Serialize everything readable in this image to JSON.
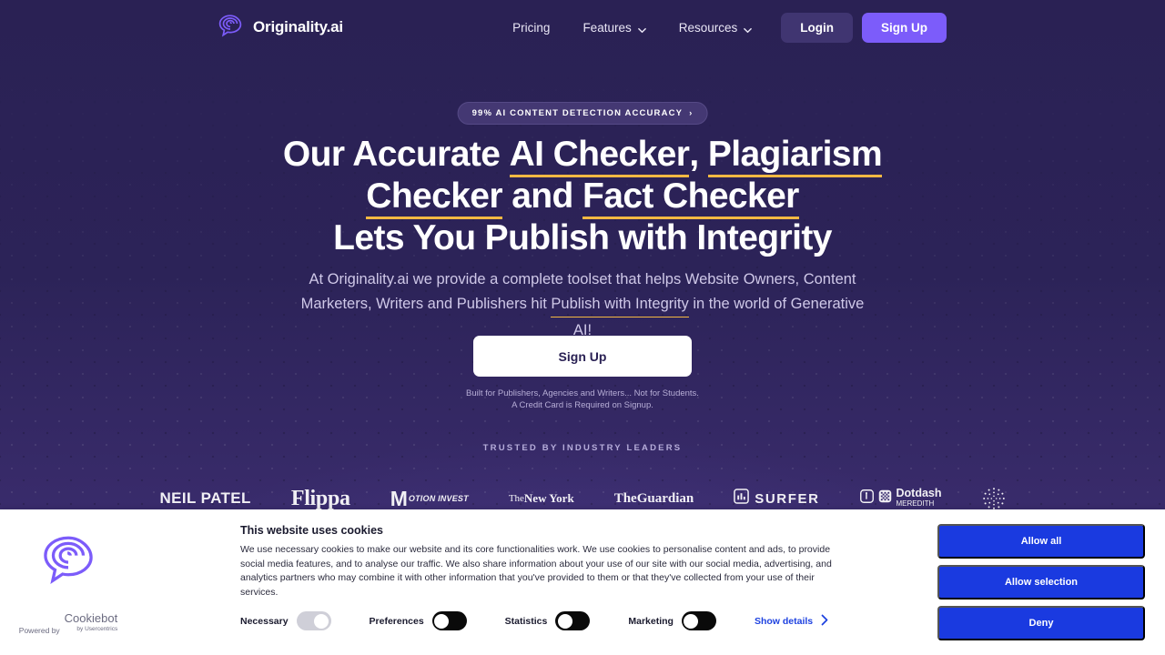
{
  "colors": {
    "hero_bg_top": "#2a2154",
    "hero_bg_bottom": "#41317a",
    "accent_purple": "#7c5cfa",
    "underline_gold": "#f5b942",
    "cookie_button_blue": "#1a3ae0",
    "show_details_blue": "#1e42e0"
  },
  "nav": {
    "brand": "Originality.ai",
    "brand_icon": "brain-speech-bubble-logo",
    "links": [
      {
        "label": "Pricing",
        "has_caret": false
      },
      {
        "label": "Features",
        "has_caret": true
      },
      {
        "label": "Resources",
        "has_caret": true
      }
    ],
    "login_label": "Login",
    "signup_label": "Sign Up"
  },
  "hero": {
    "badge_text": "99% AI CONTENT DETECTION ACCURACY",
    "badge_arrow": "›",
    "headline": {
      "line1_a": "Our Accurate ",
      "line1_b": "AI Checker",
      "line1_c": ", ",
      "line1_d": "Plagiarism",
      "line2_a": "Checker",
      "line2_b": " and ",
      "line2_c": "Fact Checker",
      "line3": "Lets You Publish with Integrity"
    },
    "subheading": {
      "part1": "At Originality.ai we provide a complete toolset that helps Website Owners, Content Marketers, Writers and Publishers hit ",
      "highlight": "Publish with Integrity",
      "part2": " in the world of Generative AI!"
    },
    "cta_label": "Sign Up",
    "fineprint_line1": "Built for Publishers, Agencies and Writers... Not for Students.",
    "fineprint_line2": "A Credit Card is Required on Signup.",
    "trusted_label": "TRUSTED BY INDUSTRY LEADERS",
    "logos": [
      {
        "name": "neil-patel",
        "text": "NEIL PATEL"
      },
      {
        "name": "flippa",
        "text": "Flippa"
      },
      {
        "name": "motion-invest",
        "mark": "M",
        "text": "OTION INVEST"
      },
      {
        "name": "the-new-york-times",
        "line1": "The",
        "line2": "New York"
      },
      {
        "name": "the-guardian",
        "line1": "The",
        "line2": "Guardian"
      },
      {
        "name": "surfer",
        "text": "SURFER"
      },
      {
        "name": "dotdash-meredith",
        "text": "Dotdash",
        "sub": "MEREDITH"
      },
      {
        "name": "dotted-circle-logo",
        "text": ""
      }
    ]
  },
  "cookie_banner": {
    "logo_icon": "brain-speech-bubble-logo",
    "title": "This website uses cookies",
    "body": "We use necessary cookies to make our website and its core functionalities work. We use cookies to personalise content and ads, to provide social media features, and to analyse our traffic. We also share information about your use of our site with our social media, advertising, and analytics partners who may combine it with other information that you've provided to them or that they've collected from your use of their services.",
    "toggles": [
      {
        "label": "Necessary",
        "state": "on-disabled"
      },
      {
        "label": "Preferences",
        "state": "off"
      },
      {
        "label": "Statistics",
        "state": "off"
      },
      {
        "label": "Marketing",
        "state": "off"
      }
    ],
    "show_details_label": "Show details",
    "show_details_arrow": "›",
    "buttons": [
      {
        "name": "allow-all",
        "label": "Allow all"
      },
      {
        "name": "allow-selection",
        "label": "Allow selection"
      },
      {
        "name": "deny",
        "label": "Deny"
      }
    ],
    "powered_by_prefix": "Powered by",
    "powered_by_name": "Cookiebot",
    "powered_by_sub": "by Usercentrics"
  }
}
